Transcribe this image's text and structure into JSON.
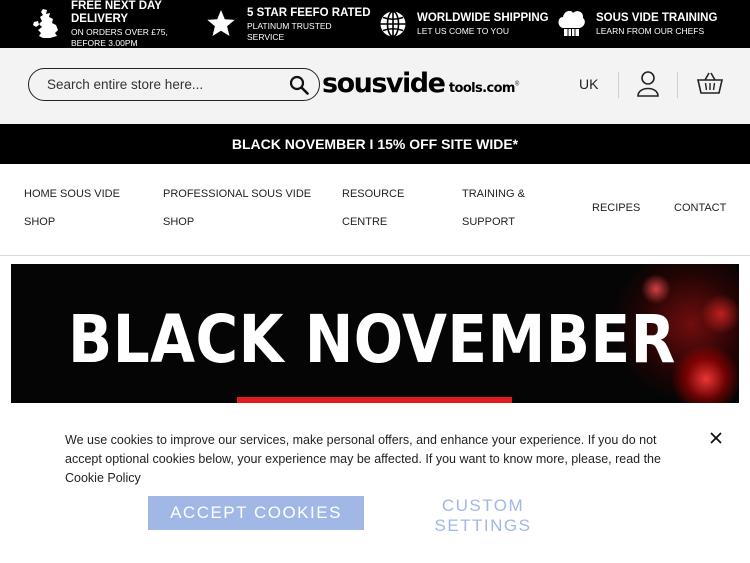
{
  "usp": [
    {
      "title_line1": "FREE NEXT DAY",
      "title_line2": "DELIVERY",
      "sub_line1": "ON ORDERS OVER £75,",
      "sub_line2": "BEFORE 3.00PM",
      "icon": "uk-map-icon"
    },
    {
      "title": "5 STAR FEEFO RATED",
      "sub_line1": "PLATINUM TRUSTED",
      "sub_line2": "SERVICE",
      "icon": "star-icon"
    },
    {
      "title": "WORLDWIDE SHIPPING",
      "sub": "LET US COME TO YOU",
      "icon": "globe-icon"
    },
    {
      "title": "SOUS VIDE TRAINING",
      "sub": "LEARN FROM OUR CHEFS",
      "icon": "chef-hat-icon"
    }
  ],
  "header": {
    "search_placeholder": "Search entire store here...",
    "logo_main": "sousvide",
    "logo_suffix": "tools.com",
    "logo_mark": "®",
    "language": "UK"
  },
  "promo": {
    "text": "BLACK NOVEMBER I 15% OFF SITE WIDE*"
  },
  "nav": {
    "items": [
      {
        "line1": "HOME SOUS VIDE",
        "line2": "SHOP"
      },
      {
        "line1": "PROFESSIONAL SOUS VIDE",
        "line2": "SHOP"
      },
      {
        "line1": "RESOURCE",
        "line2": "CENTRE"
      },
      {
        "line1": "TRAINING &",
        "line2": "SUPPORT"
      },
      {
        "line1": "RECIPES"
      },
      {
        "line1": "CONTACT"
      }
    ]
  },
  "hero": {
    "title": "BLACK NOVEMBER",
    "accent_color": "#e21b1b"
  },
  "cookie": {
    "text": "We use cookies to improve our services, make personal offers, and enhance your experience. If you do not accept optional cookies below, your experience may be affected. If you want to know more, please, read the Cookie Policy",
    "accept_label": "ACCEPT COOKIES",
    "custom_label": "CUSTOM SETTINGS",
    "button_color": "#a1b8e6"
  }
}
